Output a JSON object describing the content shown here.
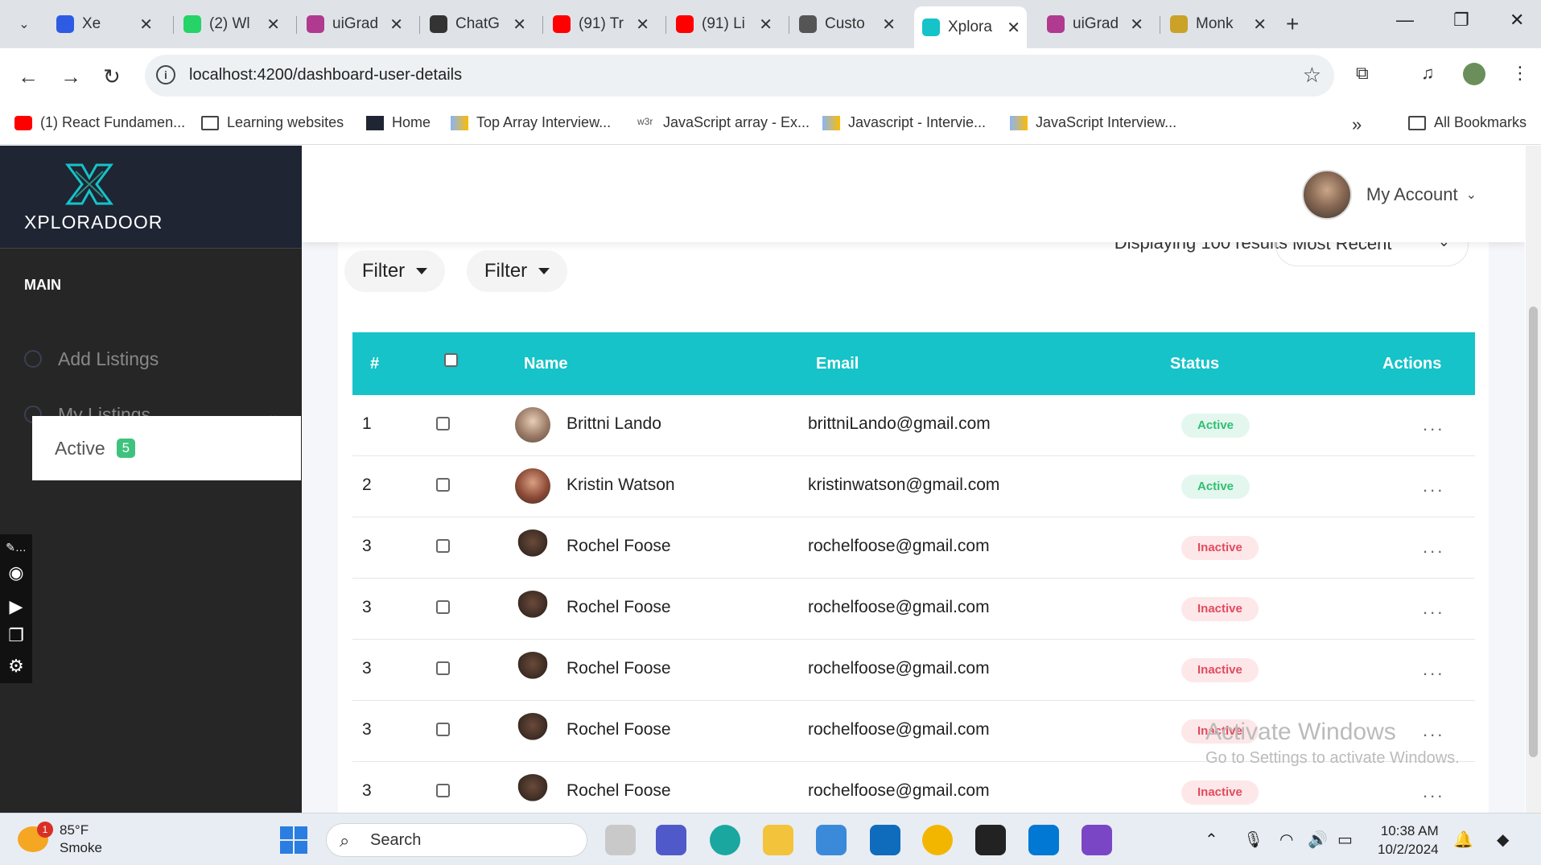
{
  "browser": {
    "tabs": [
      {
        "label": "Xe",
        "color": "#2d5be3",
        "icon": "zoom-icon"
      },
      {
        "label": "(2) Wl",
        "color": "#25d366",
        "icon": "whatsapp-icon"
      },
      {
        "label": "uiGrad",
        "color": "#b03a8f",
        "icon": "uigrad-icon"
      },
      {
        "label": "ChatG",
        "color": "#333333",
        "icon": "chatgpt-icon"
      },
      {
        "label": "(91) Tr",
        "color": "#ff0000",
        "icon": "youtube-icon"
      },
      {
        "label": "(91) Li",
        "color": "#ff0000",
        "icon": "youtube-icon"
      },
      {
        "label": "Custo",
        "color": "#555555",
        "icon": "globe-icon"
      },
      {
        "label": "Xplora",
        "color": "#15c3c8",
        "icon": "xploradoor-icon"
      },
      {
        "label": "uiGrad",
        "color": "#b03a8f",
        "icon": "uigrad-icon"
      },
      {
        "label": "Monk",
        "color": "#c9a227",
        "icon": "monkeytype-icon"
      }
    ],
    "url": "localhost:4200/dashboard-user-details",
    "bookmarks": [
      "(1) React Fundamen...",
      "Learning websites",
      "Home",
      "Top Array Interview...",
      "JavaScript array - Ex...",
      "Javascript - Intervie...",
      "JavaScript Interview..."
    ],
    "all_bookmarks": "All Bookmarks",
    "more": "»"
  },
  "app": {
    "logo_text": "XPLORADOOR",
    "account_label": "My Account",
    "sidebar": {
      "heading": "MAIN",
      "items": [
        {
          "label": "Add Listings"
        },
        {
          "label": "My Listings"
        }
      ],
      "active_label": "Active",
      "active_count": "5"
    },
    "filters": [
      "Filter",
      "Filter"
    ],
    "displaying": "Displaying 100 results",
    "sort": "Most Recent",
    "table": {
      "headers": [
        "#",
        "Name",
        "Email",
        "Status",
        "Actions"
      ],
      "rows": [
        {
          "num": "1",
          "name": "Brittni Lando",
          "email": "brittniLando@gmail.com",
          "status": "Active"
        },
        {
          "num": "2",
          "name": "Kristin Watson",
          "email": "kristinwatson@gmail.com",
          "status": "Active"
        },
        {
          "num": "3",
          "name": "Rochel Foose",
          "email": "rochelfoose@gmail.com",
          "status": "Inactive"
        },
        {
          "num": "3",
          "name": "Rochel Foose",
          "email": "rochelfoose@gmail.com",
          "status": "Inactive"
        },
        {
          "num": "3",
          "name": "Rochel Foose",
          "email": "rochelfoose@gmail.com",
          "status": "Inactive"
        },
        {
          "num": "3",
          "name": "Rochel Foose",
          "email": "rochelfoose@gmail.com",
          "status": "Inactive"
        },
        {
          "num": "3",
          "name": "Rochel Foose",
          "email": "rochelfoose@gmail.com",
          "status": "Inactive"
        }
      ],
      "actions": "..."
    }
  },
  "watermark": {
    "line1": "Activate Windows",
    "line2": "Go to Settings to activate Windows."
  },
  "taskbar": {
    "temperature": "85°F",
    "weather": "Smoke",
    "notification_count": "1",
    "search": "Search",
    "time": "10:38 AM",
    "date": "10/2/2024"
  }
}
